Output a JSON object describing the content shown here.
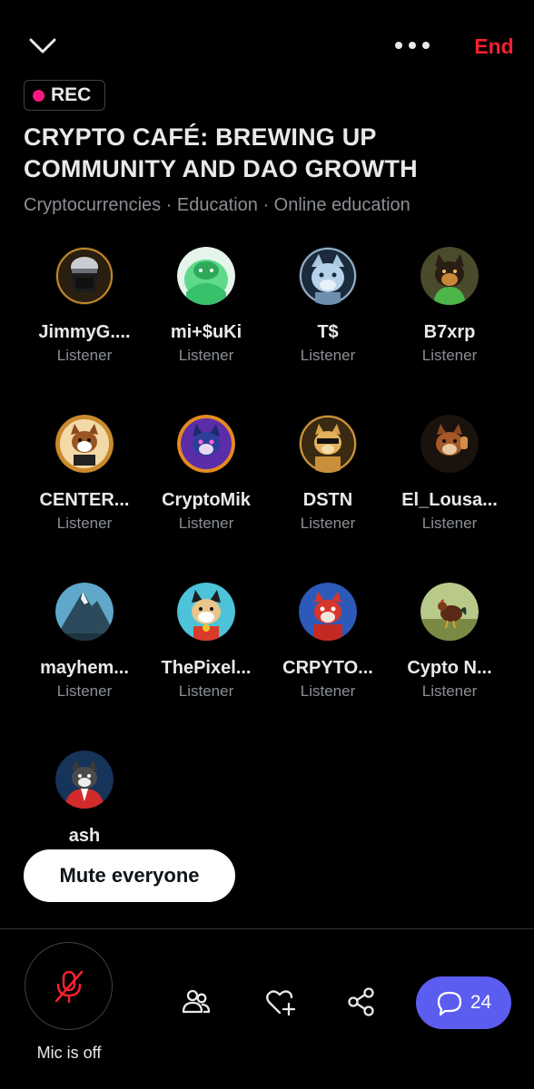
{
  "header": {
    "end_label": "End",
    "collapse_icon": "chevron-down-icon",
    "more_icon": "more-dots-icon"
  },
  "space": {
    "rec_label": "REC",
    "title_line1": "CRYPTO CAFÉ: BREWING UP",
    "title_line2": "COMMUNITY AND DAO GROWTH",
    "topics": "Cryptocurrencies · Education · Online education"
  },
  "participants": [
    {
      "name": "JimmyG....",
      "role": "Listener"
    },
    {
      "name": "mi+$uKi",
      "role": "Listener"
    },
    {
      "name": "T$",
      "role": "Listener"
    },
    {
      "name": "B7xrp",
      "role": "Listener"
    },
    {
      "name": "CENTER...",
      "role": "Listener"
    },
    {
      "name": "CryptoMik",
      "role": "Listener"
    },
    {
      "name": "DSTN",
      "role": "Listener"
    },
    {
      "name": "El_Lousa...",
      "role": "Listener"
    },
    {
      "name": "mayhem...",
      "role": "Listener"
    },
    {
      "name": "ThePixel...",
      "role": "Listener"
    },
    {
      "name": "CRPYTO...",
      "role": "Listener"
    },
    {
      "name": "Cypto N...",
      "role": "Listener"
    },
    {
      "name": "ash",
      "role": ""
    }
  ],
  "controls": {
    "mute_everyone_label": "Mute everyone",
    "mic_label": "Mic is off",
    "chat_count": "24"
  },
  "colors": {
    "end": "#f4212e",
    "rec_dot": "#f91880",
    "chat_button": "#5b5cf0",
    "mic_off": "#f4212e"
  }
}
